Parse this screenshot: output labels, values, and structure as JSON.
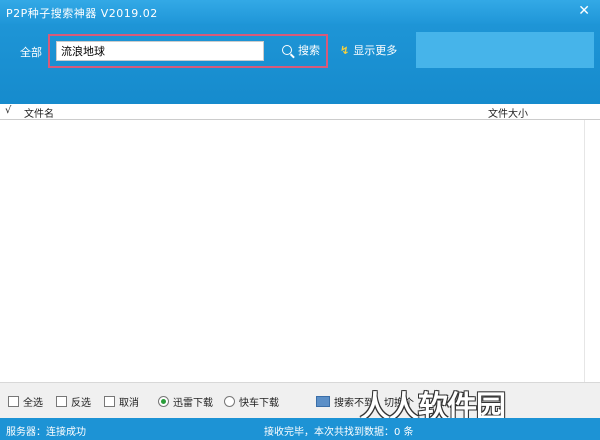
{
  "window": {
    "title": "P2P种子搜索神器 V2019.02",
    "close_glyph": "✕"
  },
  "toolbar": {
    "category_label": "全部",
    "search_value": "流浪地球",
    "search_button_label": "搜索",
    "more_button_icon": "green-arrow-icon",
    "more_button_label": "显示更多"
  },
  "list": {
    "checkbox_header": "√",
    "columns": [
      "文件名",
      "文件大小"
    ],
    "rows": []
  },
  "options": {
    "select_all": "全选",
    "invert_select": "反选",
    "cancel": "取消",
    "thunder_download": "迅雷下载",
    "other_download": "快车下载",
    "search_not_found": "搜索不到",
    "switch_label": "切换个"
  },
  "watermark": "人人软件园",
  "status": {
    "server": "服务器：连接成功",
    "info": "接收完毕，本次共找到数据：0 条"
  },
  "colors": {
    "accent": "#1f96d8",
    "highlight_border": "#d85a7a",
    "radio_on": "#2a9d3a"
  }
}
